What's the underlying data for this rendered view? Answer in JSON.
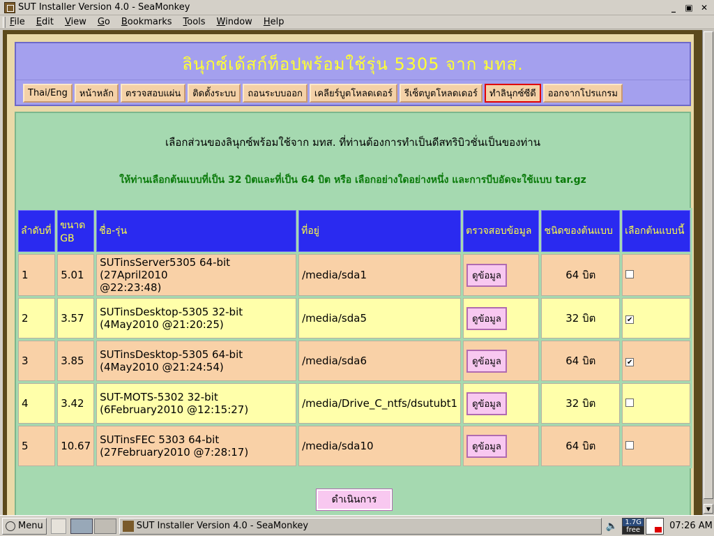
{
  "window": {
    "title": "SUT Installer Version 4.0 - SeaMonkey",
    "controls": [
      "_",
      "▣",
      "✕"
    ]
  },
  "menu": [
    {
      "label": "File",
      "key": "F",
      "rest": "ile"
    },
    {
      "label": "Edit",
      "key": "E",
      "rest": "dit"
    },
    {
      "label": "View",
      "key": "V",
      "rest": "iew"
    },
    {
      "label": "Go",
      "key": "G",
      "rest": "o"
    },
    {
      "label": "Bookmarks",
      "key": "B",
      "rest": "ookmarks"
    },
    {
      "label": "Tools",
      "key": "T",
      "rest": "ools"
    },
    {
      "label": "Window",
      "key": "W",
      "rest": "indow"
    },
    {
      "label": "Help",
      "key": "H",
      "rest": "elp"
    }
  ],
  "header": {
    "title": "ลินุกซ์เด้สก์ท็อปพร้อมใช้รุ่น 5305 จาก มทส."
  },
  "nav": [
    {
      "label": "Thai/Eng",
      "active": false
    },
    {
      "label": "หน้าหลัก",
      "active": false
    },
    {
      "label": "ตรวจสอบแผ่น",
      "active": false
    },
    {
      "label": "ติดตั้งระบบ",
      "active": false
    },
    {
      "label": "ถอนระบบออก",
      "active": false
    },
    {
      "label": "เคลียร์บูตโหลดเดอร์",
      "active": false
    },
    {
      "label": "รีเซ็ตบูตโหลดเดอร์",
      "active": false
    },
    {
      "label": "ทำลินุกซ์ซีดี",
      "active": true
    },
    {
      "label": "ออกจากโปรแกรม",
      "active": false
    }
  ],
  "main": {
    "intro": "เลือกส่วนของลินุกซ์พร้อมใช้จาก มทส. ที่ท่านต้องการทำเป็นดีสทริบิวชั่นเป็นของท่าน",
    "notice": "ให้ท่านเลือกต้นแบบที่เป็น 32 บิตและที่เป็น 64 บิต หรือ เลือกอย่างใดอย่างหนึ่ง และการบีบอัดจะใช้แบบ tar.gz",
    "columns": [
      "ลำดับที่",
      "ขนาด GB",
      "ชื่อ-รุ่น",
      "ที่อยู่",
      "ตรวจสอบข้อมูล",
      "ชนิดของต้นแบบ",
      "เลือกต้นแบบนี้"
    ],
    "view_label": "ดูข้อมูล",
    "rows": [
      {
        "no": "1",
        "size": "5.01",
        "name_line1": "SUTinsServer5305 64-bit (27April2010",
        "name_line2": "@22:23:48)",
        "path": "/media/sda1",
        "type": "64 บิต",
        "checked": false
      },
      {
        "no": "2",
        "size": "3.57",
        "name_line1": "SUTinsDesktop-5305 32-bit",
        "name_line2": "(4May2010 @21:20:25)",
        "path": "/media/sda5",
        "type": "32 บิต",
        "checked": true
      },
      {
        "no": "3",
        "size": "3.85",
        "name_line1": "SUTinsDesktop-5305 64-bit",
        "name_line2": "(4May2010 @21:24:54)",
        "path": "/media/sda6",
        "type": "64 บิต",
        "checked": true
      },
      {
        "no": "4",
        "size": "3.42",
        "name_line1": "SUT-MOTS-5302 32-bit",
        "name_line2": "(6February2010 @12:15:27)",
        "path": "/media/Drive_C_ntfs/dsutubt1",
        "type": "32 บิต",
        "checked": false
      },
      {
        "no": "5",
        "size": "10.67",
        "name_line1": "SUTinsFEC 5303 64-bit",
        "name_line2": "(27February2010 @7:28:17)",
        "path": "/media/sda10",
        "type": "64 บิต",
        "checked": false
      }
    ],
    "proceed_label": "ดำเนินการ"
  },
  "taskbar": {
    "menu_label": "Menu",
    "task_title": "SUT Installer Version 4.0 - SeaMonkey",
    "mem_top": "1.7G",
    "mem_bottom": "free",
    "clock": "07:26 AM"
  }
}
